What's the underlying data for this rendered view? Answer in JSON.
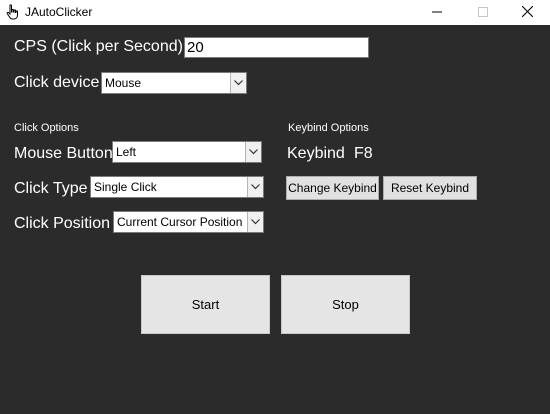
{
  "window": {
    "title": "JAutoClicker"
  },
  "cps": {
    "label": "CPS (Click per Second)",
    "value": "20"
  },
  "click_device": {
    "label": "Click device",
    "selected": "Mouse"
  },
  "click_options": {
    "heading": "Click Options",
    "mouse_button": {
      "label": "Mouse Button",
      "selected": "Left"
    },
    "click_type": {
      "label": "Click Type",
      "selected": "Single Click"
    },
    "click_position": {
      "label": "Click Position",
      "selected": "Current Cursor Position"
    }
  },
  "keybind_options": {
    "heading": "Keybind Options",
    "keybind_label": "Keybind",
    "keybind_value": "F8",
    "change_label": "Change Keybind",
    "reset_label": "Reset Keybind"
  },
  "controls": {
    "start_label": "Start",
    "stop_label": "Stop"
  },
  "icons": {
    "app": "hand-pointer-icon",
    "minimize": "minimize-icon",
    "maximize": "maximize-icon",
    "close": "close-icon",
    "dropdown": "chevron-down-icon"
  },
  "colors": {
    "background": "#2b2b2b",
    "text": "#ffffff",
    "button": "#e1e1e1"
  }
}
